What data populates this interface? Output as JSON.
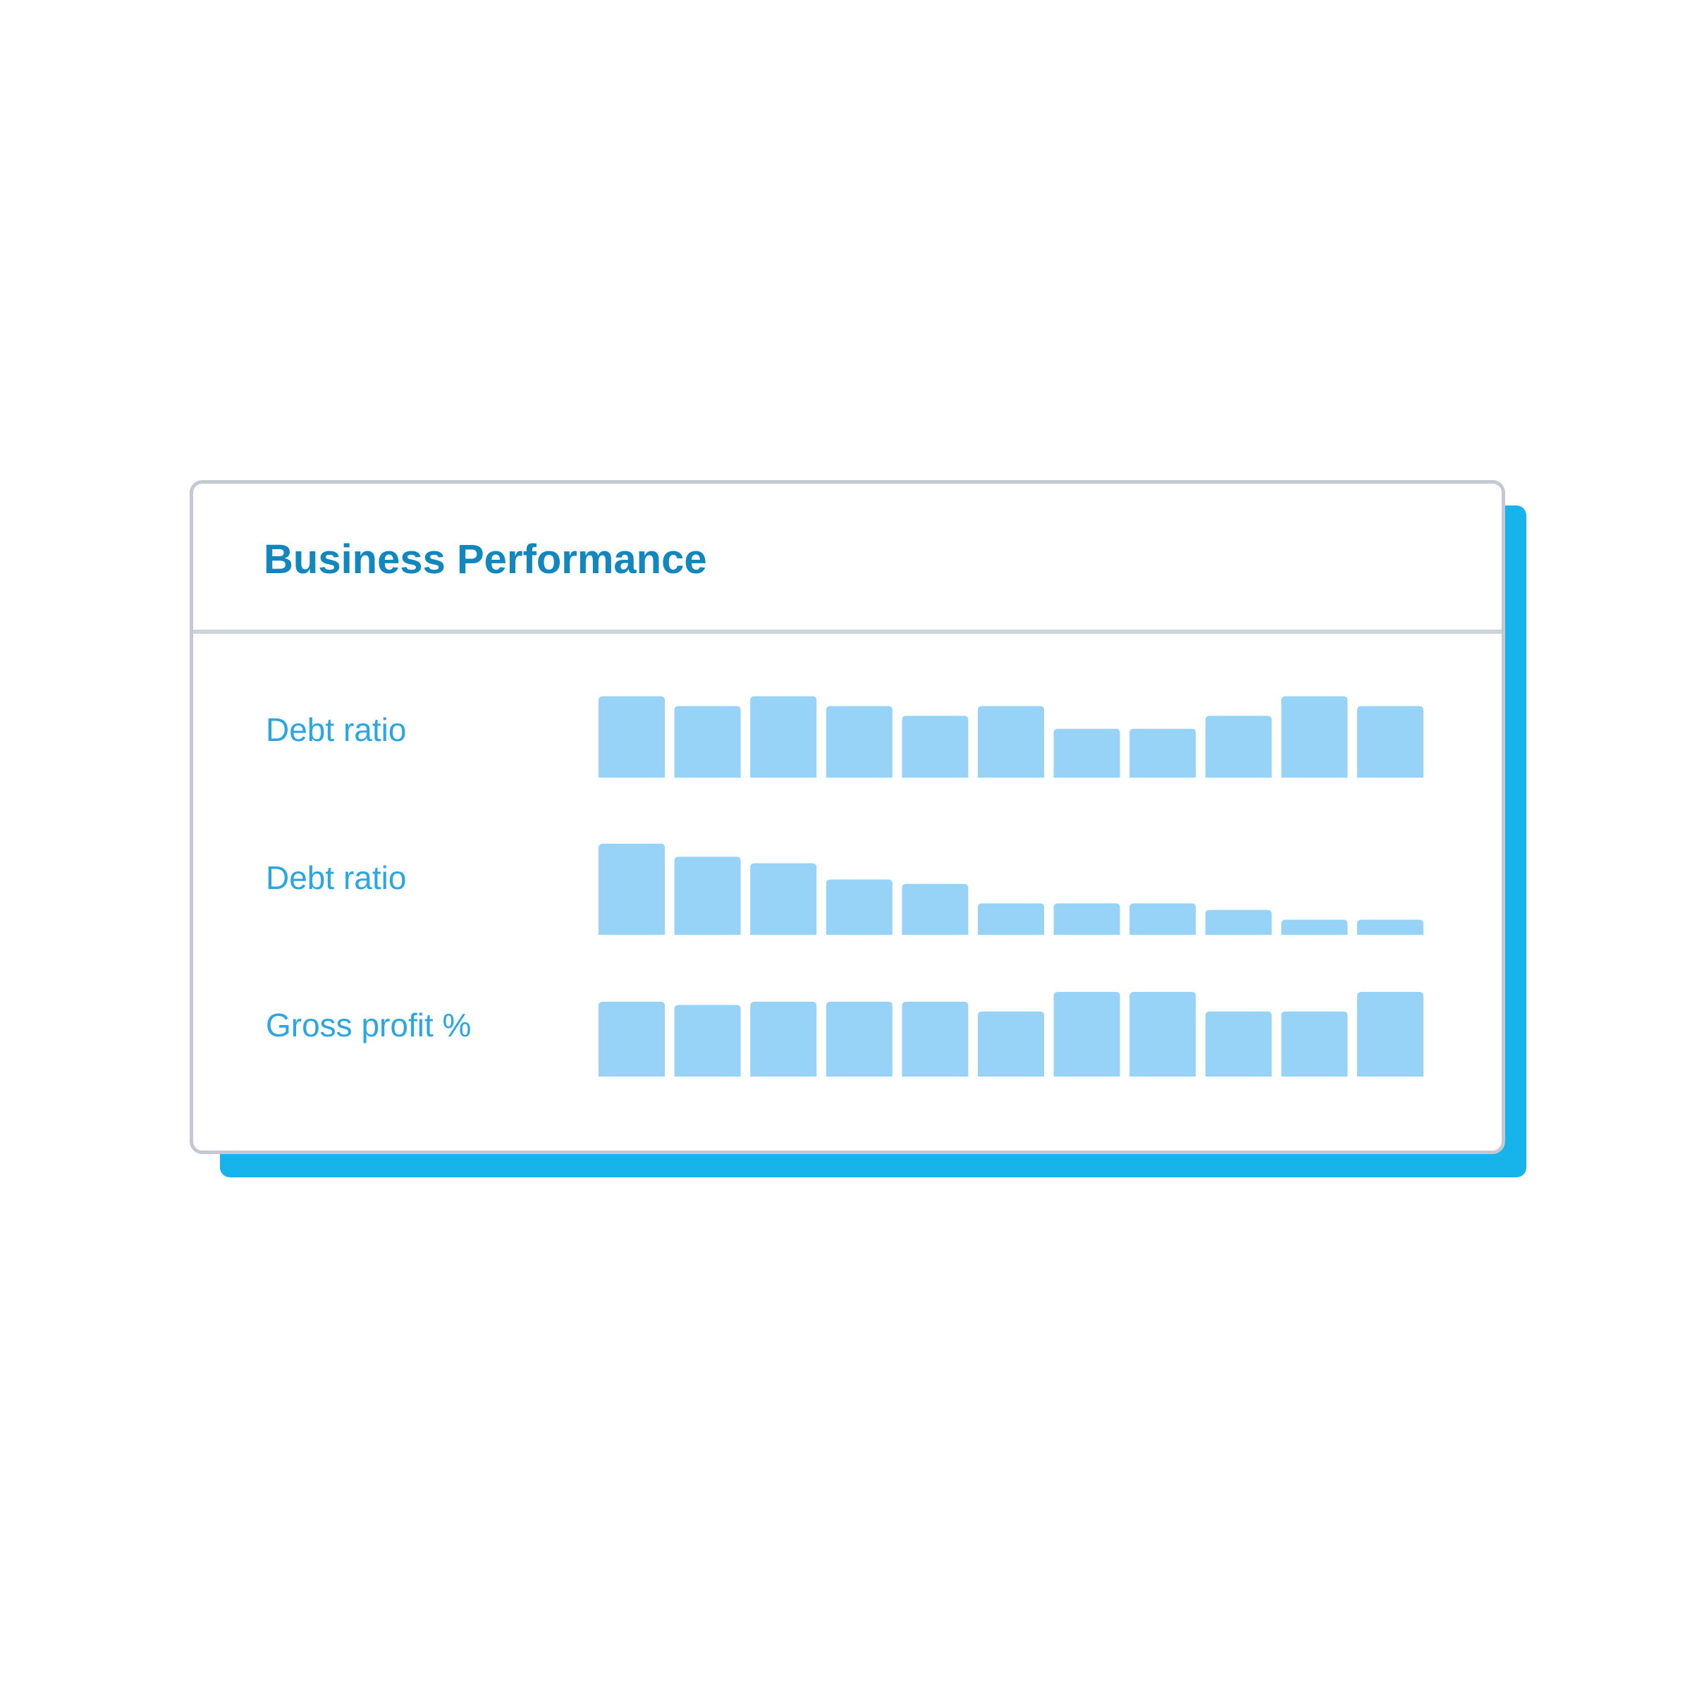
{
  "card": {
    "title": "Business Performance"
  },
  "colors": {
    "bar": "#97d3f6",
    "shadow": "#16b4ea",
    "title": "#1287bd",
    "label": "#2ba6e2"
  },
  "chart_data": [
    {
      "type": "bar",
      "label": "Debt ratio",
      "values": [
        75,
        66,
        75,
        66,
        57,
        66,
        45,
        45,
        57,
        75,
        66
      ]
    },
    {
      "type": "bar",
      "label": "Debt ratio",
      "values": [
        84,
        72,
        66,
        51,
        47,
        29,
        29,
        29,
        23,
        14,
        14
      ]
    },
    {
      "type": "bar",
      "label": "Gross profit %",
      "values": [
        69,
        66,
        69,
        69,
        69,
        60,
        78,
        78,
        60,
        60,
        78
      ]
    }
  ]
}
